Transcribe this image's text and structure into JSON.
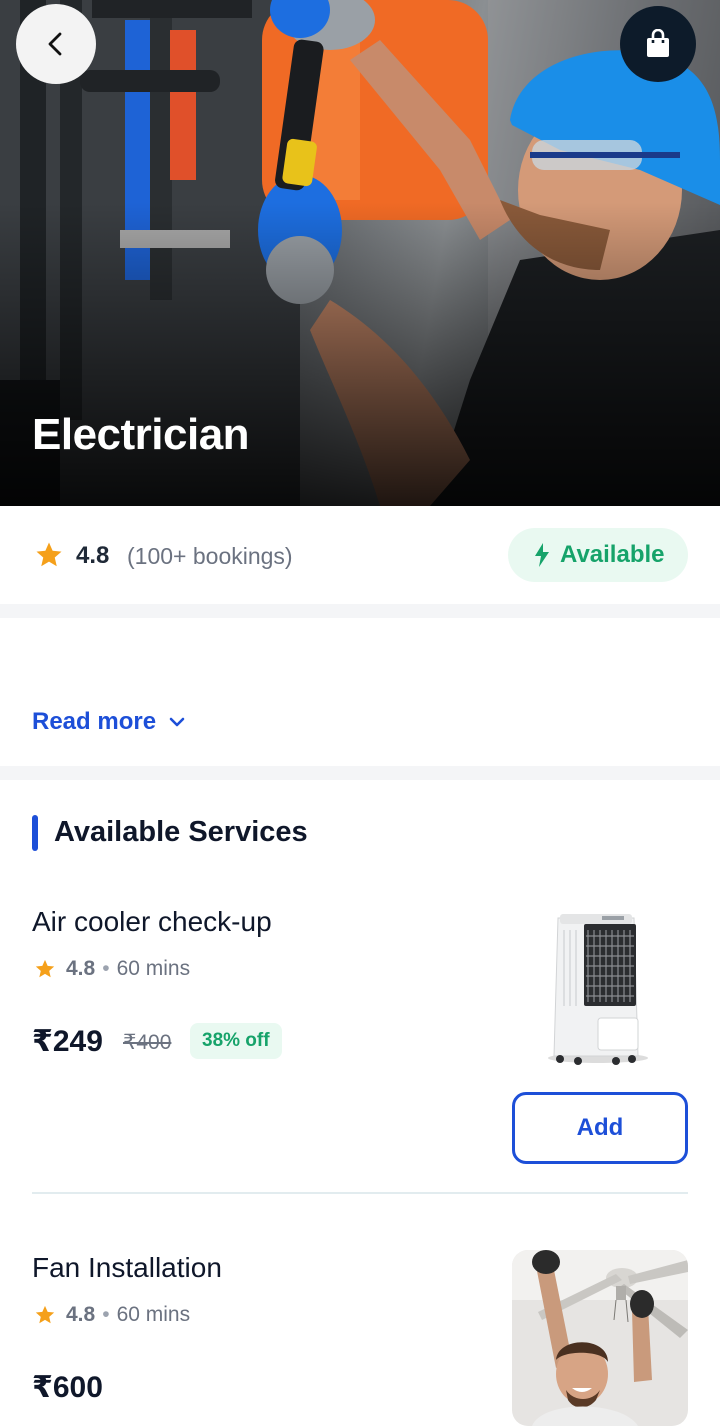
{
  "hero": {
    "title": "Electrician",
    "back_icon": "chevron-left-icon",
    "cart_icon": "shopping-bag-icon"
  },
  "summary": {
    "rating": "4.8",
    "bookings": "(100+ bookings)",
    "availability": "Available",
    "availability_icon": "lightning-bolt-icon"
  },
  "description": {
    "read_more": "Read more"
  },
  "services_section": {
    "title": "Available Services",
    "items": [
      {
        "name": "Air cooler check-up",
        "rating": "4.8",
        "separator": "•",
        "duration": "60 mins",
        "price": "₹249",
        "original_price": "₹400",
        "discount": "38% off",
        "add_label": "Add"
      },
      {
        "name": "Fan Installation",
        "rating": "4.8",
        "separator": "•",
        "duration": "60 mins",
        "price": "₹600"
      }
    ]
  },
  "colors": {
    "primary": "#1d4fd8",
    "success": "#16a36a",
    "success_bg": "#e9f9f1",
    "star": "#f5a01a",
    "dark": "#0d1b2a"
  }
}
